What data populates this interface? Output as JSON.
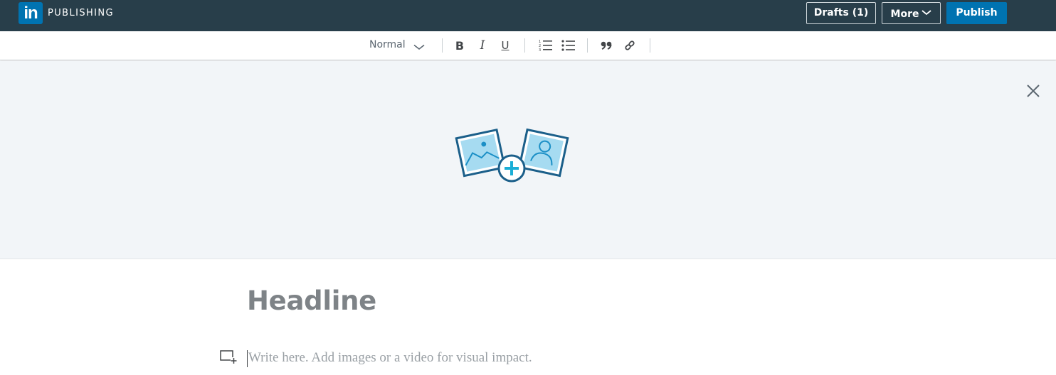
{
  "header": {
    "logo_text": "in",
    "brand": "PUBLISHING",
    "buttons": {
      "drafts": "Drafts (1)",
      "more": "More",
      "publish": "Publish"
    },
    "colors": {
      "bar": "#283e4a",
      "accent": "#0073b1"
    }
  },
  "toolbar": {
    "text_style": "Normal",
    "icons": [
      "chevron-down-icon",
      "bold-icon",
      "italic-icon",
      "underline-icon",
      "numbered-list-icon",
      "bulleted-list-icon",
      "quote-icon",
      "link-icon"
    ],
    "bold_glyph": "B",
    "italic_glyph": "I",
    "underline_glyph": "U"
  },
  "cover": {
    "icons": [
      "close-icon",
      "add-cover-image-icon"
    ],
    "background": "#f2f5f8"
  },
  "editor": {
    "headline_placeholder": "Headline",
    "body_placeholder": "Write here. Add images or a video for visual impact.",
    "icons": [
      "add-media-icon"
    ]
  }
}
